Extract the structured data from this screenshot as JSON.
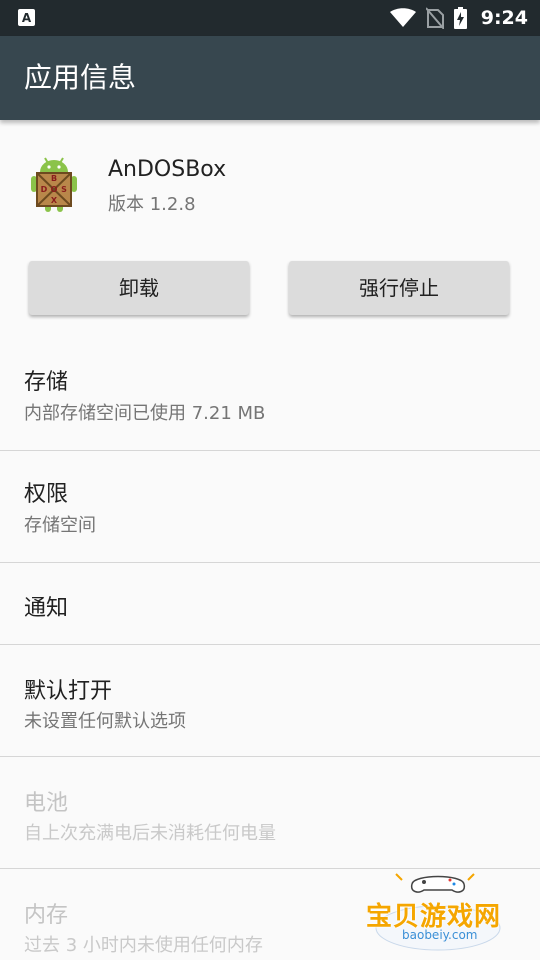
{
  "status_bar": {
    "left_icon_letter": "A",
    "time": "9:24"
  },
  "app_bar": {
    "title": "应用信息"
  },
  "app": {
    "name": "AnDOSBox",
    "version": "版本 1.2.8",
    "icon_letters": [
      "B",
      "D",
      "O",
      "S",
      "X"
    ]
  },
  "buttons": {
    "uninstall": "卸载",
    "force_stop": "强行停止"
  },
  "prefs": [
    {
      "title": "存储",
      "summary": "内部存储空间已使用 7.21 MB",
      "enabled": true
    },
    {
      "title": "权限",
      "summary": "存储空间",
      "enabled": true
    },
    {
      "title": "通知",
      "summary": "",
      "enabled": true
    },
    {
      "title": "默认打开",
      "summary": "未设置任何默认选项",
      "enabled": true
    },
    {
      "title": "电池",
      "summary": "自上次充满电后未消耗任何电量",
      "enabled": false
    },
    {
      "title": "内存",
      "summary": "过去 3 小时内未使用任何内存",
      "enabled": false
    }
  ],
  "watermark": {
    "text": "宝贝游戏网",
    "url": "baobeiy.com"
  },
  "colors": {
    "status_bar": "#222a2e",
    "app_bar": "#37474f",
    "background": "#fafafa",
    "button": "#dcdcdc",
    "disabled_text": "#c4c4c4"
  }
}
